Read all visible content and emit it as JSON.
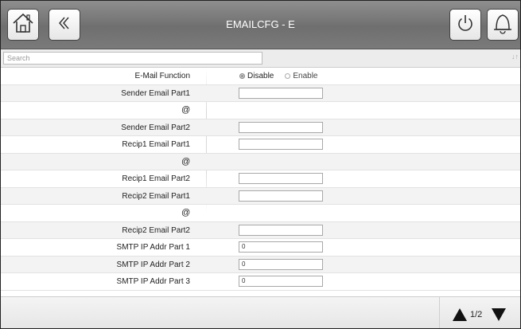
{
  "header": {
    "title": "EMAILCFG - E",
    "home_icon": "home-icon",
    "back_icon": "double-chevron-left-icon",
    "power_icon": "power-icon",
    "alarm_icon": "bell-icon"
  },
  "search": {
    "placeholder": "Search",
    "value": ""
  },
  "rows": [
    {
      "label": "E-Mail Function",
      "type": "radio",
      "options": [
        "Disable",
        "Enable"
      ],
      "selected": "Disable"
    },
    {
      "label": "Sender Email Part1",
      "type": "text",
      "value": ""
    },
    {
      "label": "@",
      "type": "separator"
    },
    {
      "label": "Sender Email Part2",
      "type": "text",
      "value": ""
    },
    {
      "label": "Recip1 Email Part1",
      "type": "text",
      "value": ""
    },
    {
      "label": "@",
      "type": "separator"
    },
    {
      "label": "Recip1 Email Part2",
      "type": "text",
      "value": ""
    },
    {
      "label": "Recip2 Email Part1",
      "type": "text",
      "value": ""
    },
    {
      "label": "@",
      "type": "separator"
    },
    {
      "label": "Recip2 Email Part2",
      "type": "text",
      "value": ""
    },
    {
      "label": "SMTP IP Addr Part 1",
      "type": "text",
      "value": "0"
    },
    {
      "label": "SMTP IP Addr Part 2",
      "type": "text",
      "value": "0"
    },
    {
      "label": "SMTP IP Addr Part 3",
      "type": "text",
      "value": "0"
    }
  ],
  "footer": {
    "page_indicator": "1/2"
  },
  "colors": {
    "header_bg": "#7a7a7a",
    "row_alt": "#f3f3f3",
    "text": "#222222"
  }
}
